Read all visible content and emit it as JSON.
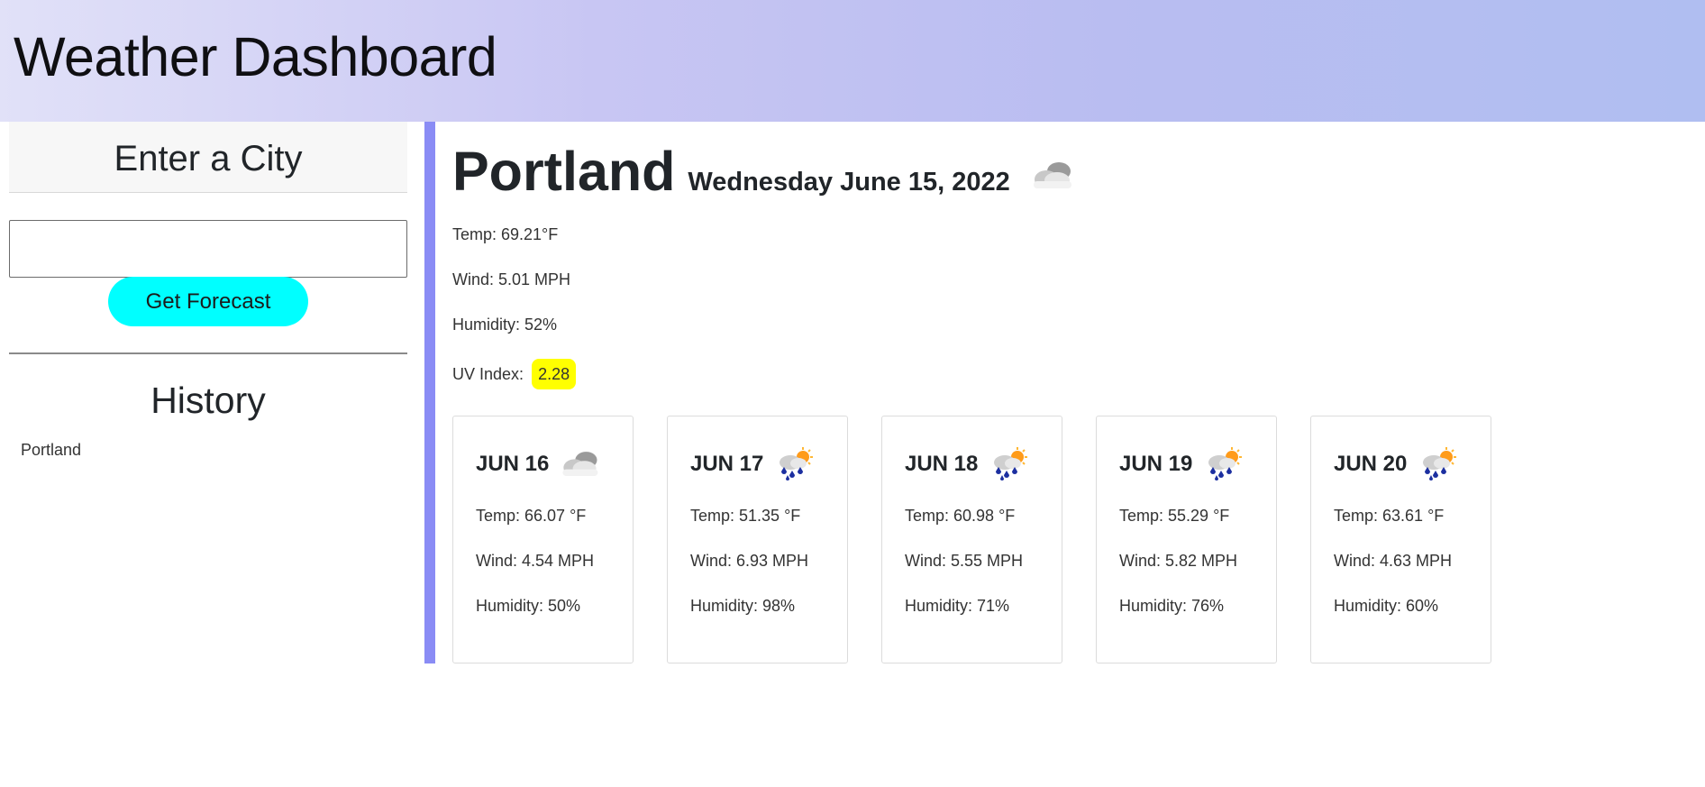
{
  "header": {
    "title": "Weather Dashboard"
  },
  "sidebar": {
    "heading": "Enter a City",
    "input_value": "",
    "button_label": "Get Forecast",
    "history_heading": "History",
    "history": [
      "Portland"
    ]
  },
  "current": {
    "city": "Portland",
    "date": "Wednesday June 15, 2022",
    "icon": "cloudy-icon",
    "temp": "Temp: 69.21°F",
    "wind": "Wind: 5.01 MPH",
    "humidity": "Humidity: 52%",
    "uv_label": "UV Index:",
    "uv_value": "2.28",
    "uv_color": "#ffff00"
  },
  "forecast": [
    {
      "date": "JUN 16",
      "icon": "cloudy-icon",
      "temp": "Temp: 66.07 °F",
      "wind": "Wind: 4.54 MPH",
      "humidity": "Humidity: 50%"
    },
    {
      "date": "JUN 17",
      "icon": "rain-sun-icon",
      "temp": "Temp: 51.35 °F",
      "wind": "Wind: 6.93 MPH",
      "humidity": "Humidity: 98%"
    },
    {
      "date": "JUN 18",
      "icon": "rain-sun-icon",
      "temp": "Temp: 60.98 °F",
      "wind": "Wind: 5.55 MPH",
      "humidity": "Humidity: 71%"
    },
    {
      "date": "JUN 19",
      "icon": "rain-sun-icon",
      "temp": "Temp: 55.29 °F",
      "wind": "Wind: 5.82 MPH",
      "humidity": "Humidity: 76%"
    },
    {
      "date": "JUN 20",
      "icon": "rain-sun-icon",
      "temp": "Temp: 63.61 °F",
      "wind": "Wind: 4.63 MPH",
      "humidity": "Humidity: 60%"
    }
  ],
  "colors": {
    "accent_bar": "#8a8cf5",
    "button": "#00ffff"
  }
}
